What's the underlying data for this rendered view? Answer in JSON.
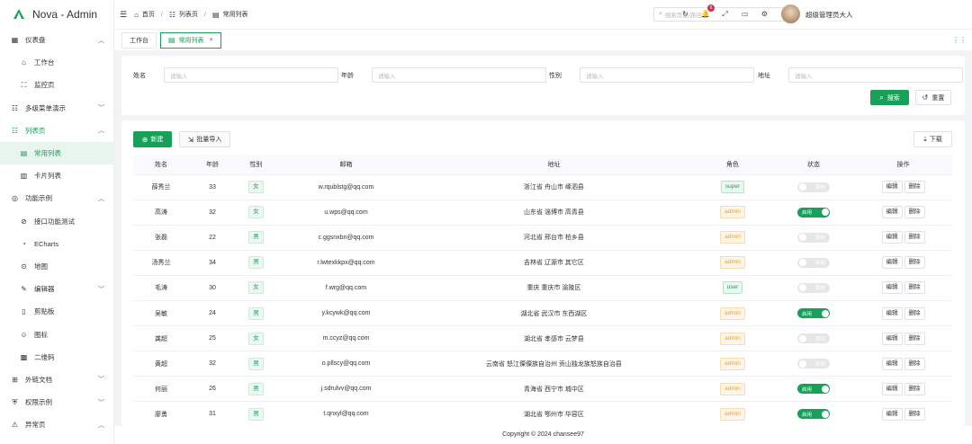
{
  "app": {
    "title": "Nova - Admin"
  },
  "sidebar": {
    "items": [
      {
        "label": "仪表盘",
        "icon": "dashboard-icon",
        "arrow": "^",
        "level": 0
      },
      {
        "label": "工作台",
        "icon": "workbench-icon",
        "arrow": "",
        "level": 1
      },
      {
        "label": "监控页",
        "icon": "monitor-icon",
        "arrow": "",
        "level": 1
      },
      {
        "label": "多级菜单演示",
        "icon": "list-icon",
        "arrow": "v",
        "level": 0
      },
      {
        "label": "列表页",
        "icon": "list-icon",
        "arrow": "^",
        "level": 0,
        "open": true
      },
      {
        "label": "常用列表",
        "icon": "table-icon",
        "arrow": "",
        "level": 1,
        "active": true
      },
      {
        "label": "卡片列表",
        "icon": "card-icon",
        "arrow": "",
        "level": 1
      },
      {
        "label": "功能示例",
        "icon": "function-icon",
        "arrow": "^",
        "level": 0
      },
      {
        "label": "接口功能测试",
        "icon": "api-icon",
        "arrow": "",
        "level": 1
      },
      {
        "label": "ECharts",
        "icon": "chart-icon",
        "arrow": "",
        "level": 1
      },
      {
        "label": "地图",
        "icon": "map-icon",
        "arrow": "",
        "level": 1
      },
      {
        "label": "编辑器",
        "icon": "editor-icon",
        "arrow": "v",
        "level": 1
      },
      {
        "label": "剪贴板",
        "icon": "clipboard-icon",
        "arrow": "",
        "level": 1
      },
      {
        "label": "图标",
        "icon": "emoji-icon",
        "arrow": "",
        "level": 1
      },
      {
        "label": "二维码",
        "icon": "qrcode-icon",
        "arrow": "",
        "level": 1
      },
      {
        "label": "外链文档",
        "icon": "link-icon",
        "arrow": "v",
        "level": 0
      },
      {
        "label": "权限示例",
        "icon": "shield-icon",
        "arrow": "v",
        "level": 0
      },
      {
        "label": "异常页",
        "icon": "error-icon",
        "arrow": "^",
        "level": 0
      }
    ]
  },
  "header": {
    "breadcrumb": [
      {
        "label": "首页",
        "icon": "home-icon"
      },
      {
        "label": "列表页",
        "icon": "list-icon"
      },
      {
        "label": "常用列表",
        "icon": "table-icon"
      }
    ],
    "search_placeholder": "搜索页面/路径",
    "notification_count": "6",
    "username": "超级管理员大人"
  },
  "tabs": [
    {
      "label": "工作台",
      "active": false
    },
    {
      "label": "常用列表",
      "active": true
    }
  ],
  "filters": {
    "name_label": "姓名",
    "name_placeholder": "请输入",
    "age_label": "年龄",
    "age_placeholder": "请输入",
    "gender_label": "性别",
    "gender_placeholder": "请输入",
    "address_label": "地址",
    "address_placeholder": "请输入",
    "search_label": "搜索",
    "reset_label": "重置"
  },
  "toolbar": {
    "new_label": "新建",
    "import_label": "批量导入",
    "download_label": "下载"
  },
  "table": {
    "columns": [
      "姓名",
      "年龄",
      "性别",
      "邮箱",
      "地址",
      "角色",
      "状态",
      "操作"
    ],
    "rows": [
      {
        "name": "薛秀兰",
        "age": "33",
        "gender": "女",
        "email": "w.rqublstg@qq.com",
        "address": "浙江省 舟山市 嵊泗县",
        "role": "super",
        "status": false
      },
      {
        "name": "高涛",
        "age": "32",
        "gender": "女",
        "email": "u.wps@qq.com",
        "address": "山东省 淄博市 高青县",
        "role": "admin",
        "status": true
      },
      {
        "name": "张磊",
        "age": "22",
        "gender": "男",
        "email": "c.ggsnxbn@qq.com",
        "address": "河北省 邢台市 柏乡县",
        "role": "admin",
        "status": false
      },
      {
        "name": "汤秀兰",
        "age": "34",
        "gender": "男",
        "email": "r.lwtexkkpx@qq.com",
        "address": "吉林省 辽源市 其它区",
        "role": "admin",
        "status": false
      },
      {
        "name": "毛涛",
        "age": "30",
        "gender": "女",
        "email": "f.wrg@qq.com",
        "address": "重庆 重庆市 渝陵区",
        "role": "user",
        "status": false
      },
      {
        "name": "吴敏",
        "age": "24",
        "gender": "男",
        "email": "y.kcywk@qq.com",
        "address": "湖北省 武汉市 东西湖区",
        "role": "admin",
        "status": true
      },
      {
        "name": "龚超",
        "age": "25",
        "gender": "女",
        "email": "m.ccyz@qq.com",
        "address": "湖北省 孝感市 云梦县",
        "role": "admin",
        "status": false
      },
      {
        "name": "黄超",
        "age": "32",
        "gender": "男",
        "email": "o.pllscy@qq.com",
        "address": "云南省 怒江傈僳族自治州 贡山独龙族怒族自治县",
        "role": "admin",
        "status": false
      },
      {
        "name": "何丽",
        "age": "26",
        "gender": "男",
        "email": "j.sdrulvv@qq.com",
        "address": "青海省 西宁市 城中区",
        "role": "admin",
        "status": true
      },
      {
        "name": "廖勇",
        "age": "31",
        "gender": "男",
        "email": "t.qnxyl@qq.com",
        "address": "湖北省 鄂州市 华容区",
        "role": "admin",
        "status": true
      }
    ],
    "status_on_label": "启用",
    "status_off_label": "禁用",
    "edit_label": "编辑",
    "delete_label": "删除"
  },
  "footer": {
    "copyright": "Copyright © 2024 chansee97"
  },
  "colors": {
    "primary": "#18a058",
    "warning": "#f0a020",
    "danger": "#d03050"
  }
}
